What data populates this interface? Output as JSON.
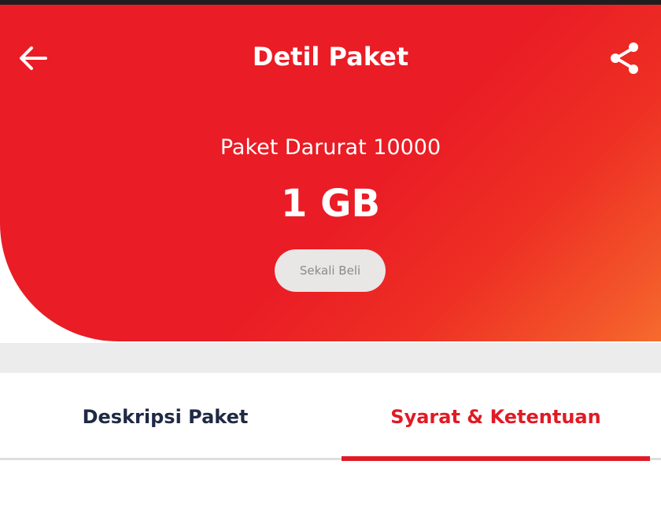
{
  "header": {
    "title": "Detil Paket",
    "back_icon": "arrow-left-icon",
    "share_icon": "share-icon"
  },
  "package": {
    "name": "Paket Darurat 10000",
    "quota": "1 GB",
    "badge": "Sekali Beli"
  },
  "tabs": [
    {
      "label": "Deskripsi Paket",
      "active": false
    },
    {
      "label": "Syarat & Ketentuan",
      "active": true
    }
  ],
  "colors": {
    "brand_red": "#ea1c25",
    "gradient_orange": "#f66b2c",
    "active_tab": "#e01b24",
    "inactive_tab": "#1f2a44",
    "badge_bg": "#e9e6e6"
  }
}
